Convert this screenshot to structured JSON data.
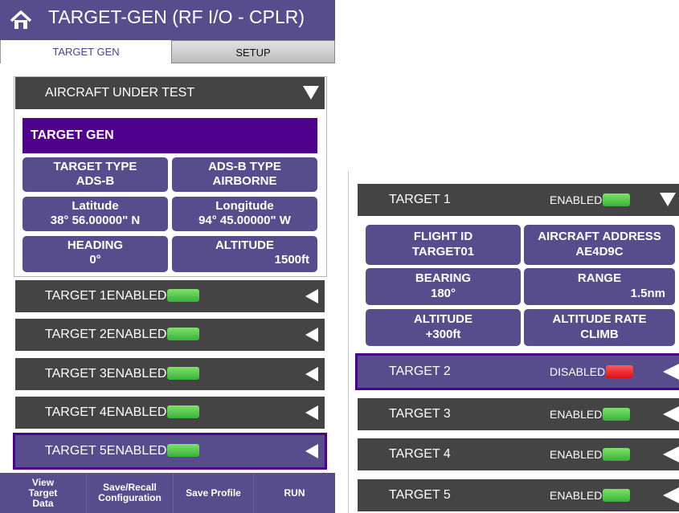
{
  "header": {
    "title": "TARGET-GEN (RF I/O - CPLR)"
  },
  "tabs": [
    {
      "label": "TARGET GEN"
    },
    {
      "label": "SETUP"
    }
  ],
  "aircraft_under_test": {
    "label": "AIRCRAFT UNDER TEST"
  },
  "target_gen": {
    "heading": "TARGET GEN",
    "fields": [
      {
        "label": "TARGET TYPE",
        "value": "ADS-B"
      },
      {
        "label": "ADS-B TYPE",
        "value": "AIRBORNE"
      },
      {
        "label": "Latitude",
        "value": "38° 56.00000\" N"
      },
      {
        "label": "Longitude",
        "value": "94° 45.00000\" W"
      },
      {
        "label": "HEADING",
        "value": "0°"
      },
      {
        "label": "ALTITUDE",
        "value": "1500ft"
      }
    ]
  },
  "left_targets": [
    {
      "label": "TARGET 1",
      "status": "ENABLED"
    },
    {
      "label": "TARGET 2",
      "status": "ENABLED"
    },
    {
      "label": "TARGET 3",
      "status": "ENABLED"
    },
    {
      "label": "TARGET 4",
      "status": "ENABLED"
    },
    {
      "label": "TARGET 5",
      "status": "ENABLED"
    }
  ],
  "bottom_bar": [
    {
      "label": "View Target Data"
    },
    {
      "label": "Save/Recall Configuration"
    },
    {
      "label": "Save Profile"
    },
    {
      "label": "RUN"
    }
  ],
  "right_panel": {
    "target1": {
      "label": "TARGET 1",
      "status": "ENABLED",
      "fields": [
        {
          "label": "FLIGHT ID",
          "value": "TARGET01"
        },
        {
          "label": "AIRCRAFT ADDRESS",
          "value": "AE4D9C"
        },
        {
          "label": "BEARING",
          "value": "180°"
        },
        {
          "label": "RANGE",
          "value": "1.5nm"
        },
        {
          "label": "ALTITUDE",
          "value": "+300ft"
        },
        {
          "label": "ALTITUDE RATE",
          "value": "CLIMB"
        }
      ]
    },
    "targets": [
      {
        "label": "TARGET 2",
        "status": "DISABLED"
      },
      {
        "label": "TARGET 3",
        "status": "ENABLED"
      },
      {
        "label": "TARGET 4",
        "status": "ENABLED"
      },
      {
        "label": "TARGET 5",
        "status": "ENABLED"
      }
    ]
  },
  "colors": {
    "accent": "#574d8c",
    "header_purple": "#4f008c",
    "row_dark": "#444444",
    "enabled": "#4cc33f",
    "disabled": "#e81c1c"
  }
}
